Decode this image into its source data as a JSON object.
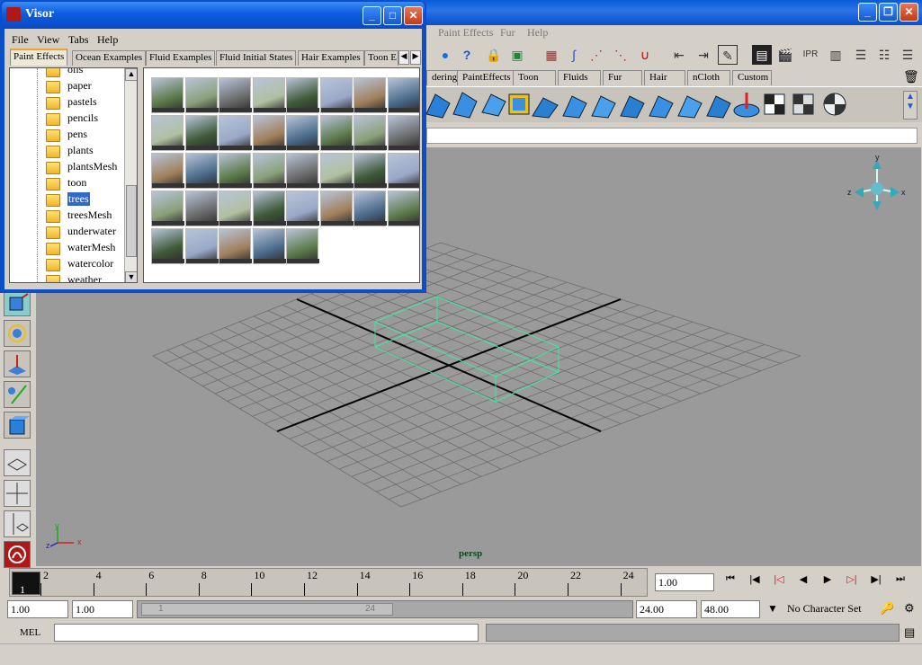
{
  "maya": {
    "menus": [
      "Paint Effects",
      "Fur",
      "Help"
    ],
    "shelf_tabs": [
      "dering",
      "PaintEffects",
      "Toon",
      "Fluids",
      "Fur",
      "Hair",
      "nCloth",
      "Custom"
    ]
  },
  "viewport": {
    "camera_label": "persp",
    "axis_x": "x",
    "axis_y": "y",
    "axis_z": "z"
  },
  "timeline": {
    "ticks": [
      "2",
      "4",
      "6",
      "8",
      "10",
      "12",
      "14",
      "16",
      "18",
      "20",
      "22",
      "24"
    ],
    "current_frame": "1",
    "current_field": "1.00"
  },
  "range": {
    "start": "1.00",
    "playback_start": "1.00",
    "slider_start": "1",
    "slider_end": "24",
    "playback_end": "24.00",
    "end": "48.00",
    "character_set": "No Character Set"
  },
  "cmdline": {
    "label": "MEL"
  },
  "visor": {
    "title": "Visor",
    "menus": [
      "File",
      "View",
      "Tabs",
      "Help"
    ],
    "tabs": [
      "Paint Effects",
      "Ocean Examples",
      "Fluid Examples",
      "Fluid Initial States",
      "Hair Examples",
      "Toon E"
    ],
    "folders": [
      "oils",
      "paper",
      "pastels",
      "pencils",
      "pens",
      "plants",
      "plantsMesh",
      "toon",
      "trees",
      "treesMesh",
      "underwater",
      "waterMesh",
      "watercolor",
      "weather"
    ],
    "selected_folder": "trees"
  },
  "colors": {
    "title_blue": "#0a5bd8",
    "viewport_bg": "#9a9a9a",
    "wire_green": "#3fe8a0",
    "selection_blue": "#316ac5"
  }
}
